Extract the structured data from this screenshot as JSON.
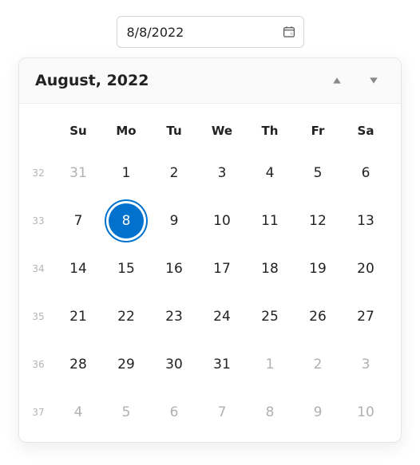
{
  "input": {
    "value": "8/8/2022",
    "icon": "calendar-icon"
  },
  "header": {
    "title": "August, 2022"
  },
  "weekdays": [
    "Su",
    "Mo",
    "Tu",
    "We",
    "Th",
    "Fr",
    "Sa"
  ],
  "selected_day": 8,
  "weeks": [
    {
      "num": "32",
      "days": [
        {
          "d": "31",
          "out": true
        },
        {
          "d": "1"
        },
        {
          "d": "2"
        },
        {
          "d": "3"
        },
        {
          "d": "4"
        },
        {
          "d": "5"
        },
        {
          "d": "6"
        }
      ]
    },
    {
      "num": "33",
      "days": [
        {
          "d": "7"
        },
        {
          "d": "8",
          "selected": true
        },
        {
          "d": "9"
        },
        {
          "d": "10"
        },
        {
          "d": "11"
        },
        {
          "d": "12"
        },
        {
          "d": "13"
        }
      ]
    },
    {
      "num": "34",
      "days": [
        {
          "d": "14"
        },
        {
          "d": "15"
        },
        {
          "d": "16"
        },
        {
          "d": "17"
        },
        {
          "d": "18"
        },
        {
          "d": "19"
        },
        {
          "d": "20"
        }
      ]
    },
    {
      "num": "35",
      "days": [
        {
          "d": "21"
        },
        {
          "d": "22"
        },
        {
          "d": "23"
        },
        {
          "d": "24"
        },
        {
          "d": "25"
        },
        {
          "d": "26"
        },
        {
          "d": "27"
        }
      ]
    },
    {
      "num": "36",
      "days": [
        {
          "d": "28"
        },
        {
          "d": "29"
        },
        {
          "d": "30"
        },
        {
          "d": "31"
        },
        {
          "d": "1",
          "out": true
        },
        {
          "d": "2",
          "out": true
        },
        {
          "d": "3",
          "out": true
        }
      ]
    },
    {
      "num": "37",
      "days": [
        {
          "d": "4",
          "out": true
        },
        {
          "d": "5",
          "out": true
        },
        {
          "d": "6",
          "out": true
        },
        {
          "d": "7",
          "out": true
        },
        {
          "d": "8",
          "out": true
        },
        {
          "d": "9",
          "out": true
        },
        {
          "d": "10",
          "out": true
        }
      ]
    }
  ]
}
